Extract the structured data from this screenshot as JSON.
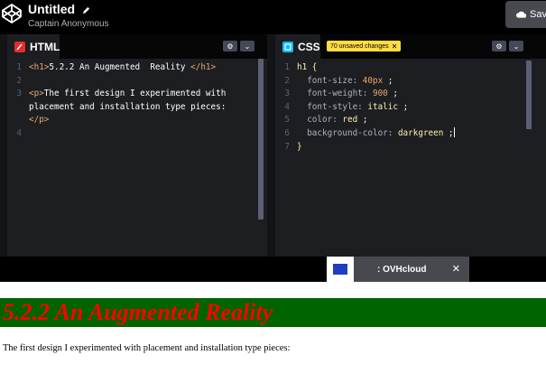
{
  "header": {
    "title": "Untitled",
    "author": "Captain Anonymous",
    "save_label": "Sav"
  },
  "html_editor": {
    "tab_label": "HTML",
    "badge_icon": "html-badge-icon",
    "lines": [
      {
        "num": "1",
        "open": "<h1>",
        "text": "5.2.2 An Augmented  Reality ",
        "close": "</h1>"
      },
      {
        "num": "2",
        "open": "",
        "text": "",
        "close": ""
      },
      {
        "num": "3",
        "open": "<p>",
        "text": "The first design I experimented with",
        "close": ""
      },
      {
        "num": "",
        "open": "",
        "text": "placement and installation type pieces:",
        "close": ""
      },
      {
        "num": "",
        "open": "",
        "text": "",
        "close": "</p>"
      },
      {
        "num": "4",
        "open": "",
        "text": "",
        "close": ""
      }
    ]
  },
  "css_editor": {
    "tab_label": "CSS",
    "unsaved_label": "70 unsaved changes",
    "lines": [
      {
        "num": "1",
        "prop": "",
        "value": "",
        "selector": "h1 {"
      },
      {
        "num": "2",
        "prop": "font-size: ",
        "value": "40px",
        "selector": ""
      },
      {
        "num": "3",
        "prop": "font-weight: ",
        "value": "900",
        "selector": ""
      },
      {
        "num": "4",
        "prop": "font-style: ",
        "value": "italic",
        "selector": ""
      },
      {
        "num": "5",
        "prop": "color: ",
        "value": "red",
        "selector": ""
      },
      {
        "num": "6",
        "prop": "background-color: ",
        "value": "darkgreen",
        "selector": ""
      },
      {
        "num": "7",
        "prop": "",
        "value": "",
        "selector": "}"
      }
    ]
  },
  "ad": {
    "text": ": OVHcloud",
    "close": "✕"
  },
  "preview": {
    "heading": "5.2.2 An Augmented Reality",
    "paragraph": "The first design I experimented with placement and installation type pieces:"
  },
  "colors": {
    "accent_html": "#e42c2c",
    "accent_css": "#0ebeff",
    "unsaved": "#ffdd40",
    "preview_bg": "#006400",
    "preview_text": "#ff0000"
  }
}
